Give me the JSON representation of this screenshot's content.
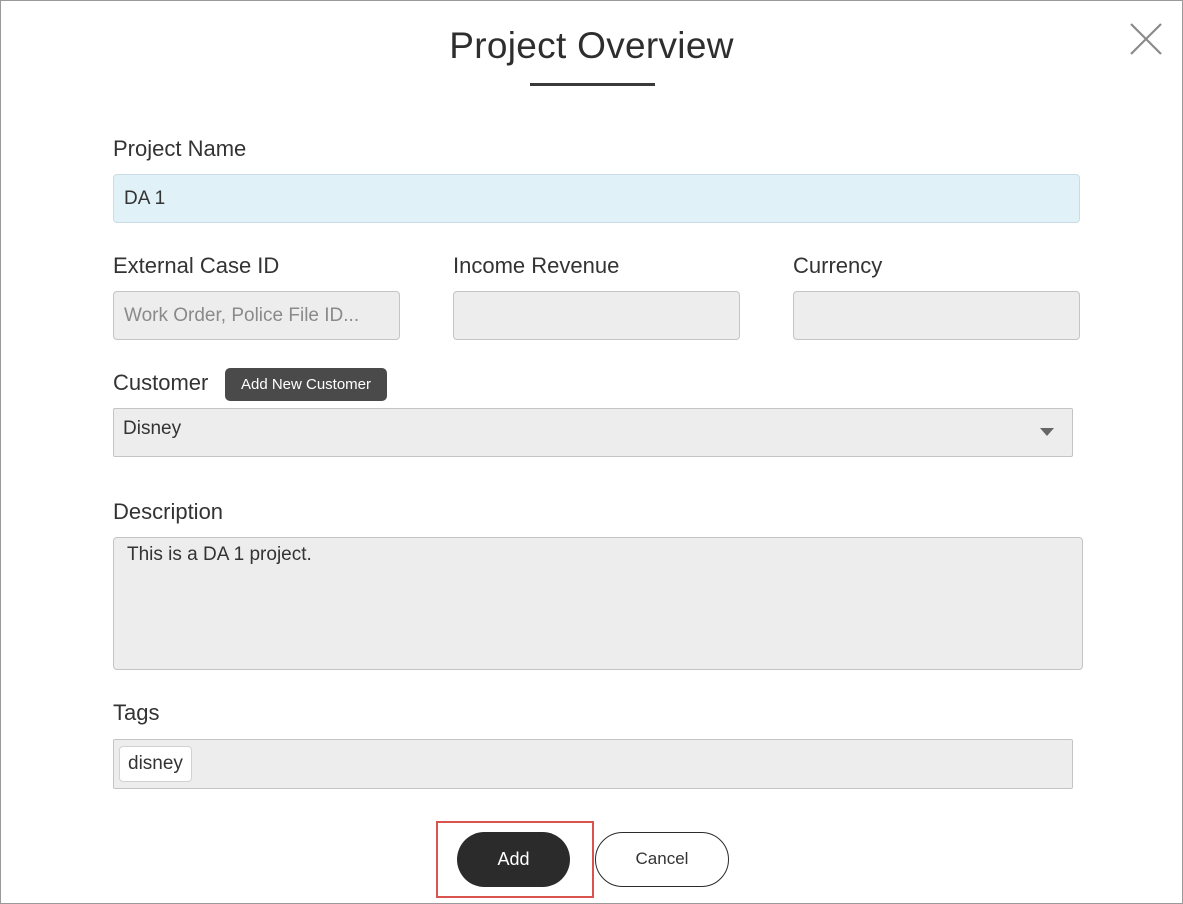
{
  "dialog": {
    "title": "Project Overview"
  },
  "icons": {
    "close": "close-icon",
    "dropdown": "chevron-down-icon"
  },
  "form": {
    "project_name": {
      "label": "Project Name",
      "value": "DA 1"
    },
    "external_case_id": {
      "label": "External Case ID",
      "value": "",
      "placeholder": "Work Order, Police File ID..."
    },
    "income_revenue": {
      "label": "Income Revenue",
      "value": ""
    },
    "currency": {
      "label": "Currency",
      "value": ""
    },
    "customer": {
      "label": "Customer",
      "add_new_label": "Add New Customer",
      "selected": "Disney"
    },
    "description": {
      "label": "Description",
      "value": "This is a DA 1 project."
    },
    "tags": {
      "label": "Tags",
      "items": [
        "disney"
      ]
    }
  },
  "actions": {
    "add_label": "Add",
    "cancel_label": "Cancel"
  },
  "colors": {
    "active_field_bg": "#e0f1f8",
    "primary_button": "#2b2b2b",
    "highlight_border": "#d9534f"
  }
}
